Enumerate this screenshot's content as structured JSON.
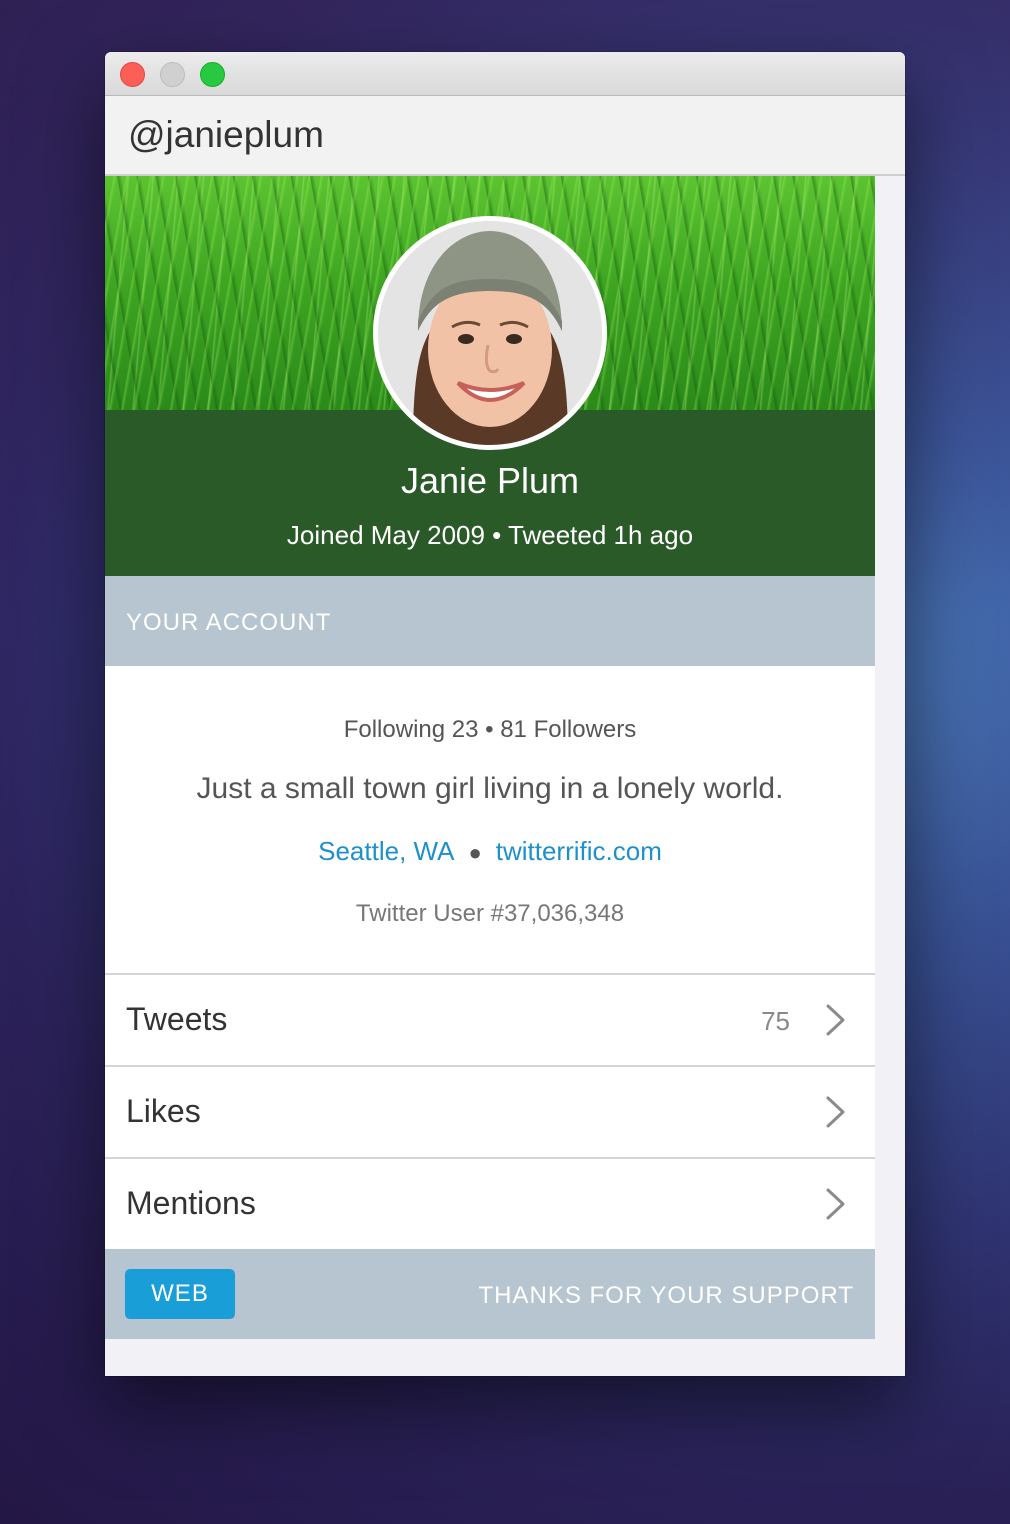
{
  "window": {
    "title": "@janieplum"
  },
  "profile": {
    "name": "Janie Plum",
    "joined": "Joined May 2009 • Tweeted 1h ago",
    "following_followers": "Following 23 • 81 Followers",
    "bio": "Just a small town girl living in a lonely world.",
    "location": "Seattle, WA",
    "website": "twitterrific.com",
    "user_number": "Twitter User #37,036,348"
  },
  "section": {
    "label": "YOUR ACCOUNT"
  },
  "rows": [
    {
      "label": "Tweets",
      "count": "75"
    },
    {
      "label": "Likes",
      "count": ""
    },
    {
      "label": "Mentions",
      "count": ""
    }
  ],
  "footer": {
    "web_label": "WEB",
    "thanks_label": "THANKS FOR YOUR SUPPORT"
  },
  "icons": {
    "row_chevron": "chevron-right-icon",
    "separator": "dot-icon"
  },
  "colors": {
    "link": "#1e90cc",
    "banner_dark": "#2b5a29",
    "section_bg": "#b6c5cf",
    "web_button": "#1a9ed8",
    "close": "#fc5f57",
    "maximize": "#28c840"
  }
}
